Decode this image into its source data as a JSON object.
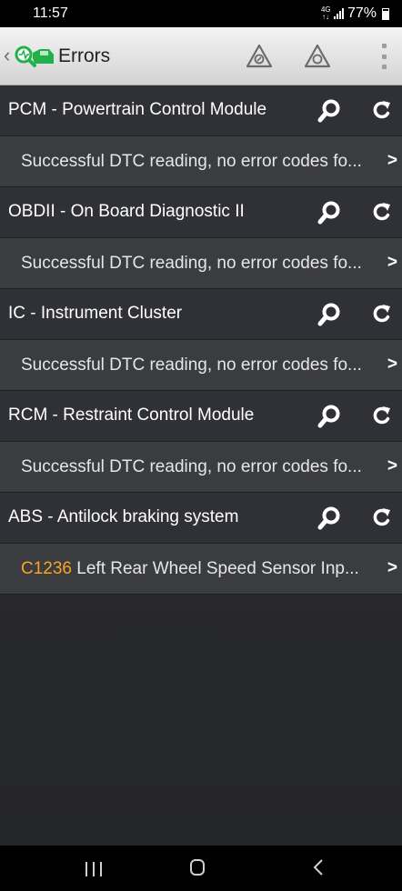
{
  "status_bar": {
    "time": "11:57",
    "network_top": "4G",
    "network_bottom": "↑↓",
    "battery": "77%"
  },
  "app_bar": {
    "title": "Errors",
    "icons": [
      "back-chevron-icon",
      "app-logo-icon",
      "warning-triangle-icon",
      "warning-triangle-icon",
      "overflow-menu-icon"
    ]
  },
  "modules": [
    {
      "title": "PCM - Powertrain Control Module",
      "result": {
        "code": "",
        "text": "Successful DTC reading, no error codes fo..."
      }
    },
    {
      "title": "OBDII - On Board Diagnostic II",
      "result": {
        "code": "",
        "text": "Successful DTC reading, no error codes fo..."
      }
    },
    {
      "title": "IC - Instrument Cluster",
      "result": {
        "code": "",
        "text": "Successful DTC reading, no error codes fo..."
      }
    },
    {
      "title": "RCM - Restraint Control Module",
      "result": {
        "code": "",
        "text": "Successful DTC reading, no error codes fo..."
      }
    },
    {
      "title": "ABS - Antilock braking system",
      "result": {
        "code": "C1236",
        "text": " Left Rear Wheel Speed Sensor Inp..."
      }
    }
  ],
  "colors": {
    "dtc_code": "#f5a623",
    "app_bar_bg": "#e4e4e4",
    "list_bg": "#303136",
    "logo_green": "#21b14b"
  },
  "nav_bar": {
    "icons": [
      "recents-icon",
      "home-icon",
      "back-icon"
    ]
  }
}
